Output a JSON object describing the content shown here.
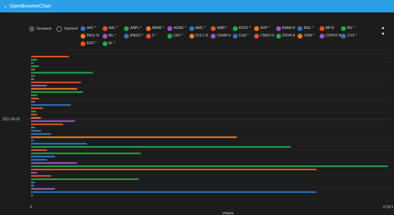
{
  "window": {
    "title": "OpenBrowserChart"
  },
  "controls": {
    "grouped_label": "Grouped",
    "stacked_label": "Stacked"
  },
  "legend": {
    "items": [
      {
        "label": "AA1 *",
        "color": "#2f74c0"
      },
      {
        "label": "AAL *",
        "color": "#e2522b"
      },
      {
        "label": "AAPL *",
        "color": "#22a94f"
      },
      {
        "label": "ABNB *",
        "color": "#f07a1f"
      },
      {
        "label": "AGNC *",
        "color": "#9b59c6"
      },
      {
        "label": "AMC *",
        "color": "#2f74c0"
      },
      {
        "label": "AMD *",
        "color": "#e2522b"
      },
      {
        "label": "ATOS *",
        "color": "#22a94f"
      },
      {
        "label": "AXP *",
        "color": "#f07a1f"
      },
      {
        "label": "BABA N",
        "color": "#9b59c6"
      },
      {
        "label": "BAC *",
        "color": "#2f74c0"
      },
      {
        "label": "BB N",
        "color": "#e2522b"
      },
      {
        "label": "BG *",
        "color": "#22a94f"
      },
      {
        "label": "BIDU N",
        "color": "#f07a1f"
      },
      {
        "label": "BIL *",
        "color": "#9b59c6"
      },
      {
        "label": "BNGO *",
        "color": "#2f74c0"
      },
      {
        "label": "C *",
        "color": "#e2522b"
      },
      {
        "label": "CAT *",
        "color": "#22a94f"
      },
      {
        "label": "CCL1 N",
        "color": "#f07a1f"
      },
      {
        "label": "CEMA N",
        "color": "#9b59c6"
      },
      {
        "label": "CHS *",
        "color": "#2f74c0"
      },
      {
        "label": "CNDX N",
        "color": "#e2522b"
      },
      {
        "label": "CNYA N",
        "color": "#22a94f"
      },
      {
        "label": "CRM *",
        "color": "#f07a1f"
      },
      {
        "label": "CSPXX N",
        "color": "#9b59c6"
      },
      {
        "label": "CVX *",
        "color": "#2f74c0"
      },
      {
        "label": "EDZ *",
        "color": "#e2522b"
      },
      {
        "label": "EL *",
        "color": "#22a94f"
      }
    ],
    "up_icon": "▲",
    "down_icon": "▼"
  },
  "chart_data": {
    "type": "bar",
    "orientation": "horizontal",
    "categories": [
      "2021-06-30"
    ],
    "xlabel": "Volume",
    "ylabel": "",
    "xlim": [
      0,
      17871
    ],
    "x_ticks": [
      {
        "value": 0,
        "label": "0"
      },
      {
        "value": 17871,
        "label": "17,871"
      }
    ],
    "grid": true,
    "legend_position": "top",
    "bars": [
      {
        "value": 1900,
        "color": "#e2522b"
      },
      {
        "value": 300,
        "color": "#22a94f"
      },
      {
        "value": 150,
        "color": "#2f74c0"
      },
      {
        "value": 400,
        "color": "#22a94f"
      },
      {
        "value": 200,
        "color": "#e2522b"
      },
      {
        "value": 3100,
        "color": "#22a94f"
      },
      {
        "value": 200,
        "color": "#2f74c0"
      },
      {
        "value": 150,
        "color": "#e2522b"
      },
      {
        "value": 2500,
        "color": "#e2522b"
      },
      {
        "value": 800,
        "color": "#9b59c6"
      },
      {
        "value": 2300,
        "color": "#f07a1f"
      },
      {
        "value": 2600,
        "color": "#22a94f"
      },
      {
        "value": 300,
        "color": "#22a94f"
      },
      {
        "value": 400,
        "color": "#e2522b"
      },
      {
        "value": 200,
        "color": "#9b59c6"
      },
      {
        "value": 2000,
        "color": "#2f74c0"
      },
      {
        "value": 600,
        "color": "#e2522b"
      },
      {
        "value": 250,
        "color": "#22a94f"
      },
      {
        "value": 300,
        "color": "#e2522b"
      },
      {
        "value": 500,
        "color": "#f07a1f"
      },
      {
        "value": 2200,
        "color": "#9b59c6"
      },
      {
        "value": 1600,
        "color": "#e2522b"
      },
      {
        "value": 200,
        "color": "#22a94f"
      },
      {
        "value": 500,
        "color": "#2f74c0"
      },
      {
        "value": 1000,
        "color": "#2f74c0"
      },
      {
        "value": 10300,
        "color": "#f07a1f"
      },
      {
        "value": 150,
        "color": "#2f74c0"
      },
      {
        "value": 2800,
        "color": "#2f74c0"
      },
      {
        "value": 13000,
        "color": "#22a94f"
      },
      {
        "value": 800,
        "color": "#e2522b"
      },
      {
        "value": 5500,
        "color": "#22a94f"
      },
      {
        "value": 1200,
        "color": "#2f74c0"
      },
      {
        "value": 800,
        "color": "#2f74c0"
      },
      {
        "value": 2300,
        "color": "#9b59c6"
      },
      {
        "value": 17871,
        "color": "#22a94f"
      },
      {
        "value": 14300,
        "color": "#e2522b"
      },
      {
        "value": 300,
        "color": "#9b59c6"
      },
      {
        "value": 1000,
        "color": "#e2522b"
      },
      {
        "value": 5400,
        "color": "#22a94f"
      },
      {
        "value": 200,
        "color": "#2f74c0"
      },
      {
        "value": 150,
        "color": "#22a94f"
      },
      {
        "value": 1200,
        "color": "#9b59c6"
      },
      {
        "value": 14300,
        "color": "#2f74c0"
      },
      {
        "value": 100,
        "color": "#22a94f"
      }
    ]
  }
}
